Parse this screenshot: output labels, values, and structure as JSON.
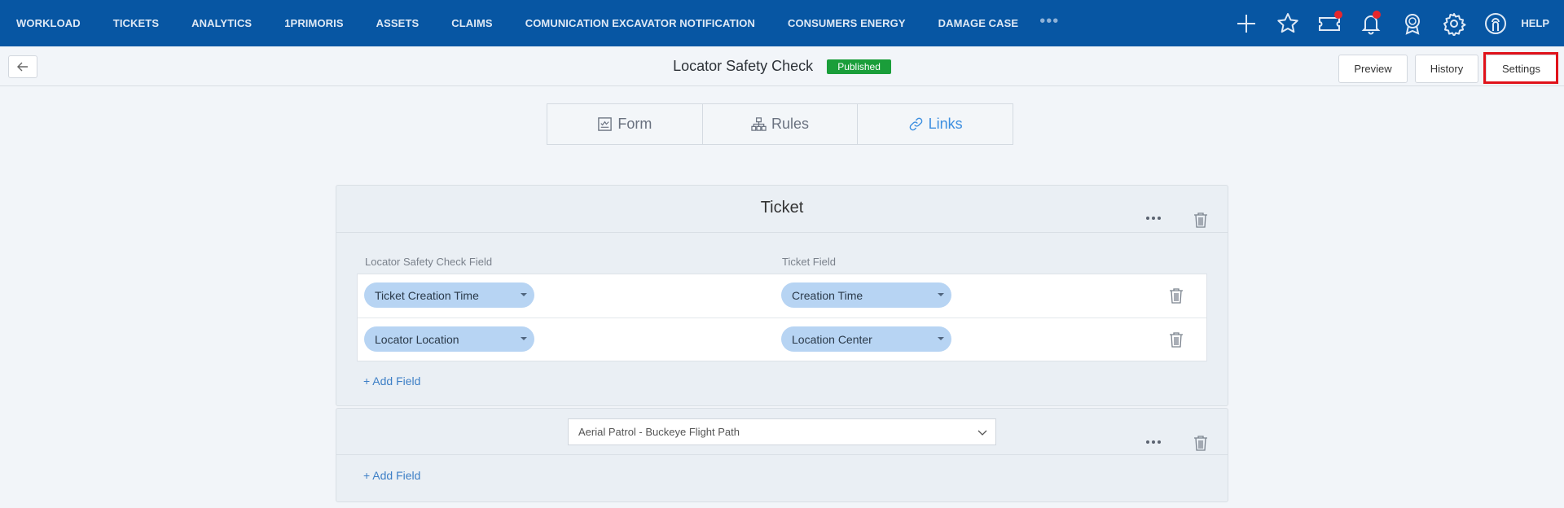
{
  "nav": {
    "items": [
      "WORKLOAD",
      "TICKETS",
      "ANALYTICS",
      "1PRIMORIS",
      "ASSETS",
      "CLAIMS",
      "COMUNICATION EXCAVATOR NOTIFICATION",
      "CONSUMERS ENERGY",
      "DAMAGE CASE"
    ],
    "more": "•••",
    "help": "HELP",
    "icons": [
      "plus-icon",
      "star-icon",
      "ticket-icon",
      "bell-icon",
      "award-icon",
      "gear-icon",
      "user-icon"
    ],
    "color": "#0756a3"
  },
  "header": {
    "title": "Locator Safety Check",
    "status": "Published",
    "status_color": "#1a9e3a",
    "preview_label": "Preview",
    "history_label": "History",
    "settings_label": "Settings"
  },
  "tabs": [
    {
      "label": "Form",
      "icon": "form-icon",
      "active": false
    },
    {
      "label": "Rules",
      "icon": "hierarchy-icon",
      "active": false
    },
    {
      "label": "Links",
      "icon": "link-icon",
      "active": true
    }
  ],
  "link_cards": [
    {
      "title": "Ticket",
      "left_header": "Locator Safety Check Field",
      "right_header": "Ticket Field",
      "rows": [
        {
          "left": "Ticket Creation Time",
          "right": "Creation Time"
        },
        {
          "left": "Locator Location",
          "right": "Location Center"
        }
      ],
      "add_field": "+ Add Field"
    },
    {
      "select_value": "Aerial Patrol - Buckeye Flight Path",
      "add_field": "+ Add Field"
    }
  ]
}
